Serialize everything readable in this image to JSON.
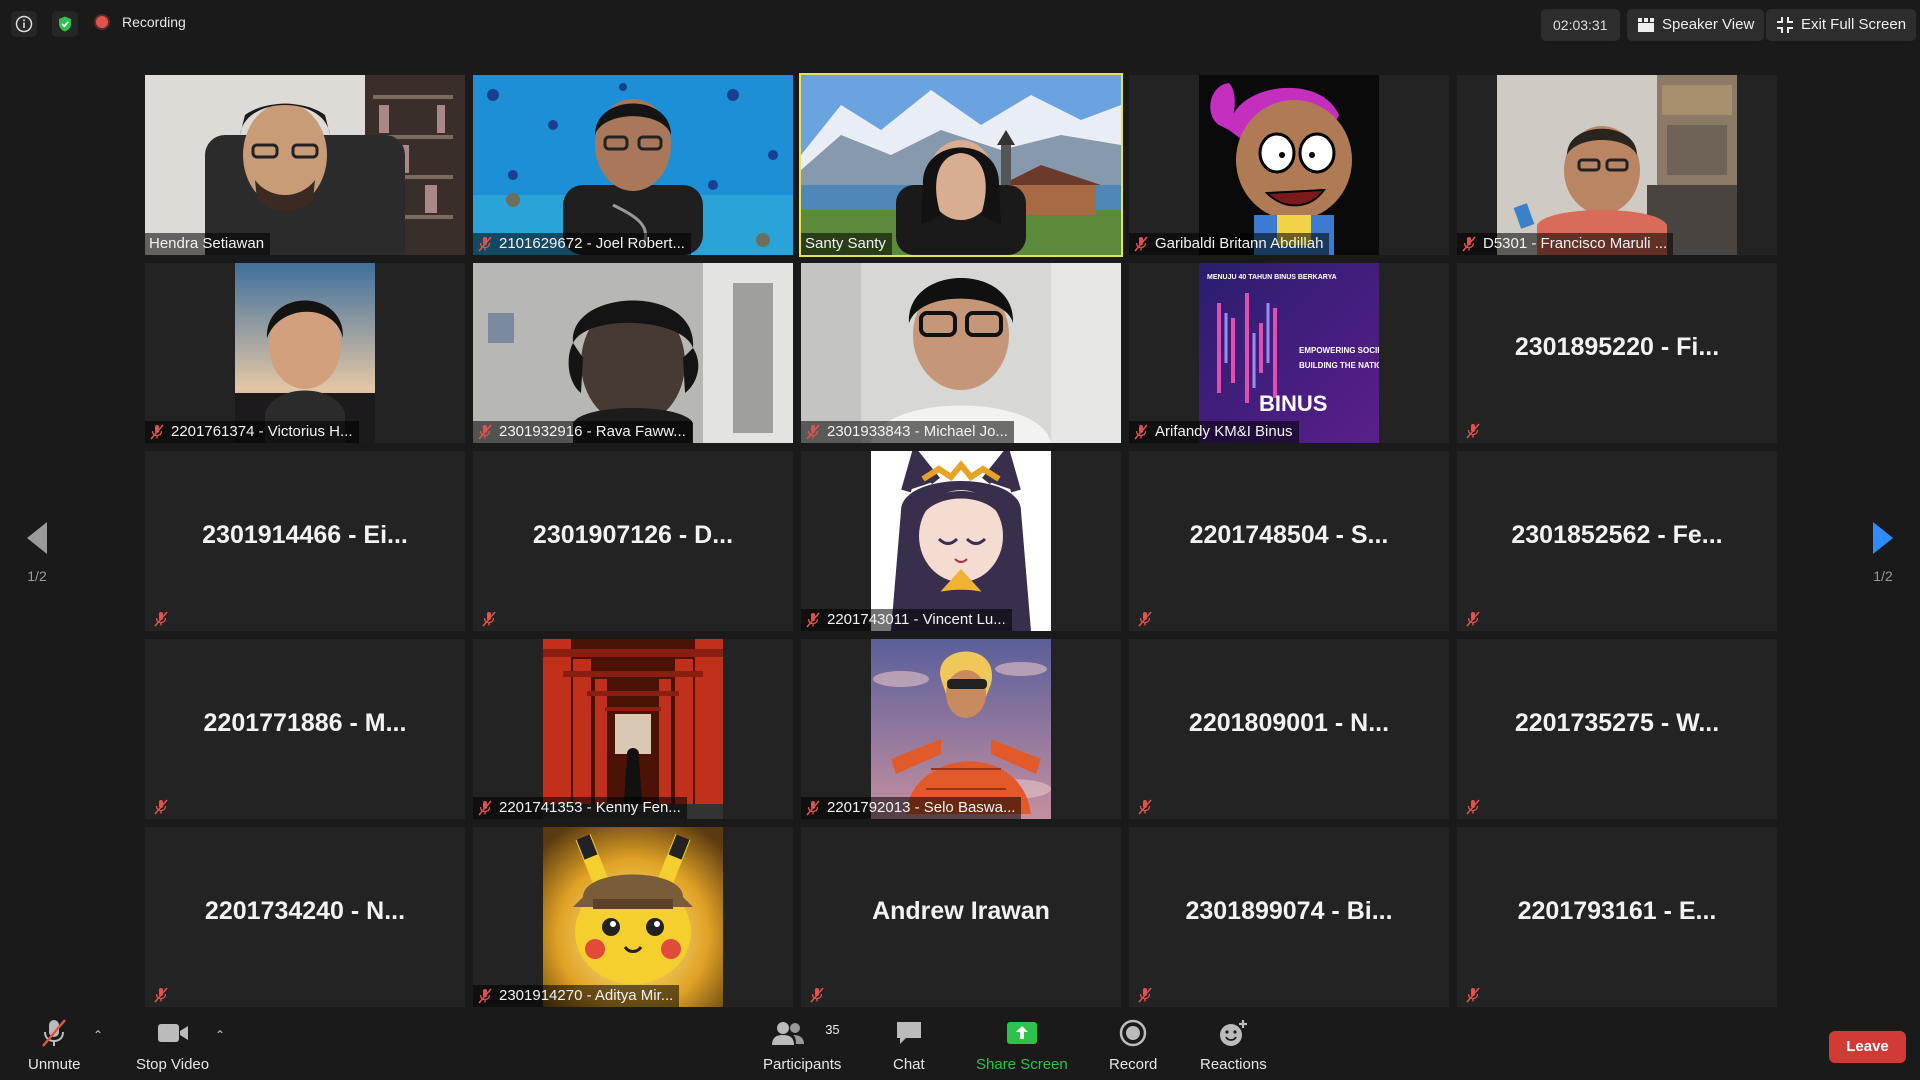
{
  "topbar": {
    "recording_label": "Recording",
    "timer": "02:03:31",
    "speaker_view_label": "Speaker View",
    "exit_fullscreen_label": "Exit Full Screen",
    "accent_green": "#2ec14b",
    "recording_color": "#e0524c"
  },
  "pager": {
    "left_page": "1/2",
    "right_page": "1/2",
    "right_arrow_color": "#2d8cff"
  },
  "tiles": [
    {
      "name": "Hendra Setiawan",
      "muted": false,
      "video": "room-shelves",
      "active": false
    },
    {
      "name": "2101629672 - Joel Robert...",
      "muted": true,
      "video": "blue-stars",
      "active": false
    },
    {
      "name": "Santy Santy",
      "muted": false,
      "video": "mountain-lake",
      "active": true
    },
    {
      "name": "Garibaldi Britann Abdillah",
      "muted": true,
      "video": "cartoon-avatar",
      "active": false
    },
    {
      "name": "D5301 - Francisco Maruli ...",
      "muted": true,
      "video": "office-desk",
      "active": false
    },
    {
      "name": "2201761374 - Victorius H...",
      "muted": true,
      "video": "sunset-portrait",
      "active": false
    },
    {
      "name": "2301932916 - Rava Faww...",
      "muted": true,
      "video": "dim-room",
      "active": false
    },
    {
      "name": "2301933843 - Michael Jo...",
      "muted": true,
      "video": "glasses-portrait",
      "active": false
    },
    {
      "name": "Arifandy KM&I Binus",
      "muted": true,
      "video": "binus-poster",
      "active": false
    },
    {
      "name": "2301895220 - Fi...",
      "muted": true,
      "video": null,
      "active": false
    },
    {
      "name": "2301914466 - Ei...",
      "muted": true,
      "video": null,
      "active": false
    },
    {
      "name": "2301907126 - D...",
      "muted": true,
      "video": null,
      "active": false
    },
    {
      "name": "2201743011 - Vincent Lu...",
      "muted": true,
      "video": "anime-girl",
      "active": false
    },
    {
      "name": "2201748504 - S...",
      "muted": true,
      "video": null,
      "active": false
    },
    {
      "name": "2301852562 - Fe...",
      "muted": true,
      "video": null,
      "active": false
    },
    {
      "name": "2201771886 - M...",
      "muted": true,
      "video": null,
      "active": false
    },
    {
      "name": "2201741353 - Kenny Fen...",
      "muted": true,
      "video": "torii-gates",
      "active": false
    },
    {
      "name": "2201792013 - Selo Baswa...",
      "muted": true,
      "video": "anime-jacket",
      "active": false
    },
    {
      "name": "2201809001 - N...",
      "muted": true,
      "video": null,
      "active": false
    },
    {
      "name": "2201735275 - W...",
      "muted": true,
      "video": null,
      "active": false
    },
    {
      "name": "2201734240 - N...",
      "muted": true,
      "video": null,
      "active": false
    },
    {
      "name": "2301914270 - Aditya Mir...",
      "muted": true,
      "video": "pikachu",
      "active": false
    },
    {
      "name": "Andrew Irawan",
      "muted": true,
      "video": null,
      "active": false
    },
    {
      "name": "2301899074 - Bi...",
      "muted": true,
      "video": null,
      "active": false
    },
    {
      "name": "2201793161 - E...",
      "muted": true,
      "video": null,
      "active": false
    }
  ],
  "binus_poster": {
    "line1": "MENUJU 40 TAHUN BINUS BERKARYA",
    "line2": "EMPOWERING SOCIETY",
    "line3": "BUILDING THE NATION",
    "brand": "BINUS"
  },
  "toolbar": {
    "unmute_label": "Unmute",
    "stop_video_label": "Stop Video",
    "participants_label": "Participants",
    "participants_count": "35",
    "chat_label": "Chat",
    "share_screen_label": "Share Screen",
    "record_label": "Record",
    "reactions_label": "Reactions",
    "leave_label": "Leave",
    "share_color": "#2ec14b",
    "leave_color": "#d23a35"
  }
}
